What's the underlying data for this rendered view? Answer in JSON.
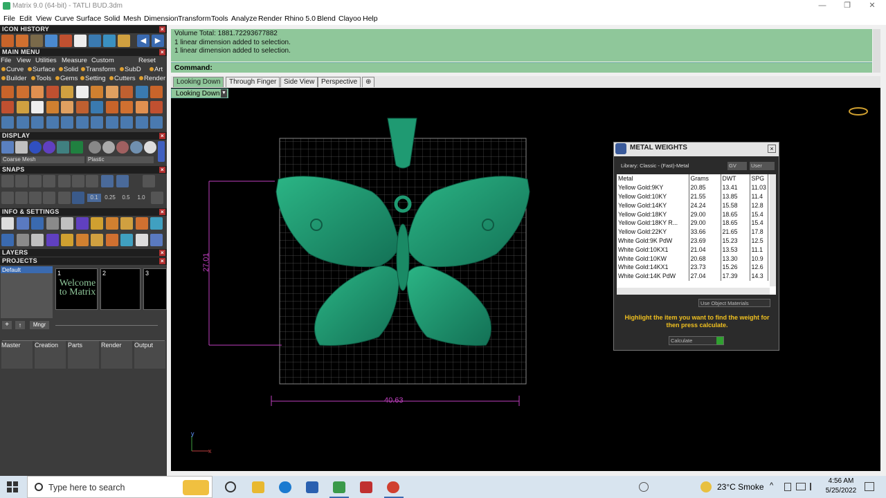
{
  "window": {
    "title": "Matrix 9.0 (64-bit) - TATLI BUD.3dm"
  },
  "menubar": [
    "File",
    "Edit",
    "View",
    "Curve",
    "Surface",
    "Solid",
    "Mesh",
    "Dimension",
    "Transform",
    "Tools",
    "Analyze",
    "Render",
    "Rhino 5.0",
    "Blend",
    "Clayoo",
    "Help"
  ],
  "panels": {
    "icon_history": "ICON HISTORY",
    "main_menu": "MAIN MENU",
    "display": "DISPLAY",
    "snaps": "SNAPS",
    "info_settings": "INFO & SETTINGS",
    "layers": "LAYERS",
    "projects": "PROJECTS"
  },
  "main_menu": {
    "row1": [
      "File",
      "View",
      "Utilities",
      "Measure",
      "Custom",
      "Reset"
    ],
    "row2": [
      "Curve",
      "Surface",
      "Solid",
      "Transform",
      "SubD",
      "Art"
    ],
    "row3": [
      "Builder",
      "Tools",
      "Gems",
      "Setting",
      "Cutters",
      "Render"
    ]
  },
  "display": {
    "mesh_mode": "Coarse Mesh",
    "material": "Plastic"
  },
  "snaps": {
    "v1": "0.1",
    "v2": "0.25",
    "v3": "0.5",
    "v4": "1.0"
  },
  "projects": {
    "layer": "Default",
    "thumbs": [
      "1",
      "2",
      "3"
    ],
    "welcome": "Welcome to Matrix",
    "mngr": "Mngr",
    "groups": [
      "Master",
      "Creation",
      "Parts",
      "Render",
      "Output"
    ]
  },
  "command": {
    "lines": [
      "Volume Total: 1881.72293677882",
      "1 linear dimension added to selection.",
      "1 linear dimension added to selection."
    ],
    "prompt": "Command:"
  },
  "viewport_tabs": [
    "Looking Down",
    "Through Finger",
    "Side View",
    "Perspective"
  ],
  "viewport": {
    "label": "Looking Down",
    "dim_h": "40.63",
    "dim_v": "27.01",
    "axis_y": "y",
    "axis_x": "x"
  },
  "metal_weights": {
    "title": "METAL WEIGHTS",
    "library": "Library: Classic - (Fast)-Metal",
    "gv": "GV",
    "user": "User",
    "headers": [
      "Metal",
      "Grams",
      "DWT",
      "SPG"
    ],
    "rows": [
      [
        "Yellow Gold:9KY",
        "20.85",
        "13.41",
        "11.03"
      ],
      [
        "Yellow Gold:10KY",
        "21.55",
        "13.85",
        "11.4"
      ],
      [
        "Yellow Gold:14KY",
        "24.24",
        "15.58",
        "12.8"
      ],
      [
        "Yellow Gold:18KY",
        "29.00",
        "18.65",
        "15.4"
      ],
      [
        "Yellow Gold:18KY R...",
        "29.00",
        "18.65",
        "15.4"
      ],
      [
        "Yellow Gold:22KY",
        "33.66",
        "21.65",
        "17.8"
      ],
      [
        "White Gold:9K PdW",
        "23.69",
        "15.23",
        "12.5"
      ],
      [
        "White Gold:10KX1",
        "21.04",
        "13.53",
        "11.1"
      ],
      [
        "White Gold:10KW",
        "20.68",
        "13.30",
        "10.9"
      ],
      [
        "White Gold:14KX1",
        "23.73",
        "15.26",
        "12.6"
      ],
      [
        "White Gold:14K PdW",
        "27.04",
        "17.39",
        "14.3"
      ]
    ],
    "use_object_materials": "Use Object Materials",
    "hint": "Highlight the item you want to find the weight for then press calculate.",
    "calculate": "Calculate"
  },
  "taskbar": {
    "search_placeholder": "Type here to search",
    "weather": "23°C Smoke",
    "time": "4:56 AM",
    "date": "5/25/2022"
  },
  "colors": {
    "accent_green": "#8fc79a",
    "model_green": "#1f9a72",
    "dimension_magenta": "#c040c0",
    "hint_yellow": "#f0c020"
  }
}
